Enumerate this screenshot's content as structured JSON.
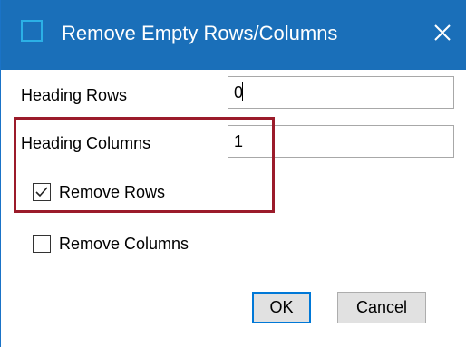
{
  "dialog": {
    "title": "Remove Empty Rows/Columns",
    "title_icon": "window-icon",
    "close_icon": "close-icon"
  },
  "fields": {
    "heading_rows": {
      "label": "Heading Rows",
      "value": "0"
    },
    "heading_columns": {
      "label": "Heading Columns",
      "value": "1"
    }
  },
  "checkboxes": {
    "remove_rows": {
      "label": "Remove Rows",
      "checked": true
    },
    "remove_columns": {
      "label": "Remove Columns",
      "checked": false
    }
  },
  "buttons": {
    "ok": "OK",
    "cancel": "Cancel"
  },
  "colors": {
    "titlebar": "#1a6fb9",
    "highlight_border": "#9b1b2a",
    "default_button_border": "#0078d7"
  }
}
